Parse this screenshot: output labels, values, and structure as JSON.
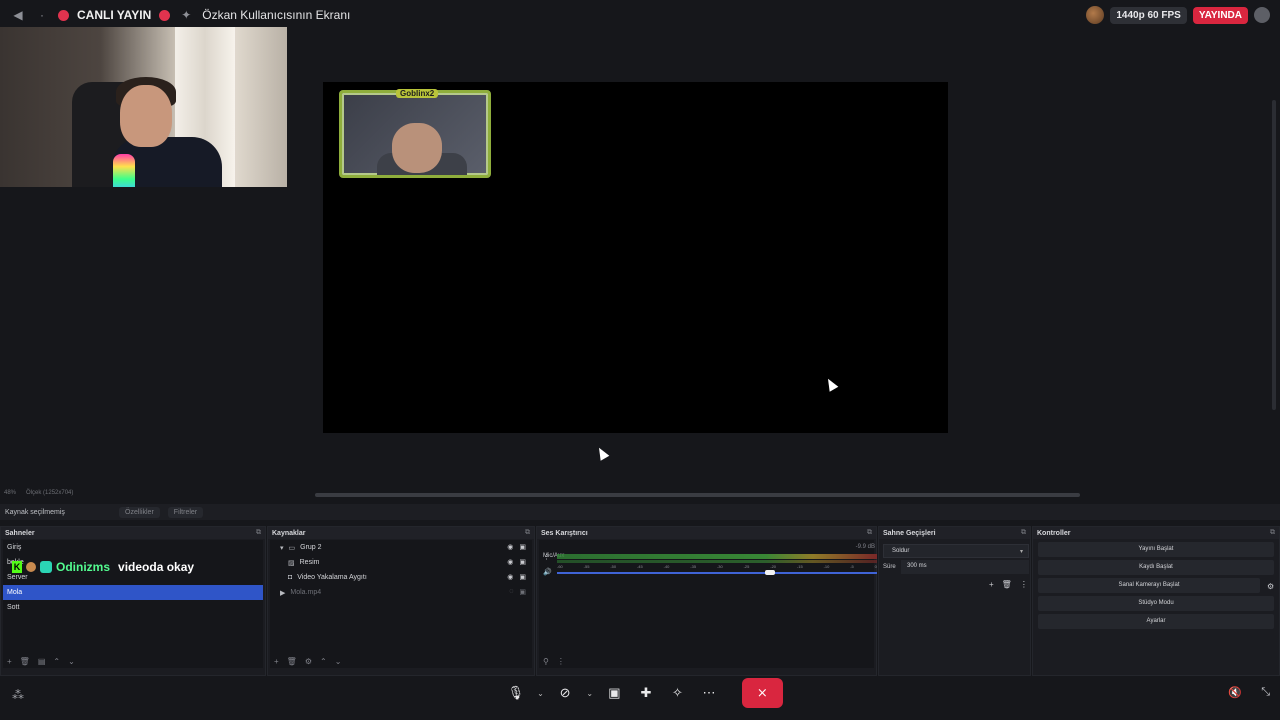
{
  "topbar": {
    "live_label": "CANLI YAYIN",
    "screen_title": "Özkan Kullanıcısının Ekranı",
    "quality": "1440p 60 FPS",
    "status": "YAYINDA"
  },
  "preview": {
    "frame_tag": "Goblinx2"
  },
  "zoombar": {
    "zoom": "48%",
    "size": "Ölçek (1252x704)"
  },
  "source_bar": {
    "none_selected": "Kaynak seçilmemiş",
    "properties": "Özellikler",
    "filters": "Filtreler"
  },
  "scenes": {
    "title": "Sahneler",
    "items": [
      {
        "label": "Giriş"
      },
      {
        "label": "bekle"
      },
      {
        "label": "Server"
      },
      {
        "label": "Mola"
      },
      {
        "label": "Sott"
      }
    ],
    "selected_index": 3
  },
  "sources": {
    "title": "Kaynaklar",
    "items": [
      {
        "label": "Grup 2"
      },
      {
        "label": "Resim"
      },
      {
        "label": "Video Yakalama Aygıtı"
      },
      {
        "label": "Mola.mp4"
      }
    ]
  },
  "mixer": {
    "title": "Ses Karıştırıcı",
    "track_name": "Mic/Aux",
    "track_db": "-9.9 dB",
    "ticks": [
      "-60",
      "-55",
      "-50",
      "-45",
      "-40",
      "-35",
      "-30",
      "-25",
      "-20",
      "-15",
      "-10",
      "-5",
      "0"
    ]
  },
  "transitions": {
    "title": "Sahne Geçişleri",
    "selected": "Soldur",
    "duration_label": "Süre",
    "duration_value": "300 ms"
  },
  "controls": {
    "title": "Kontroller",
    "start_stream": "Yayını Başlat",
    "start_record": "Kaydı Başlat",
    "start_virtualcam": "Sanal Kamerayı Başlat",
    "studio_mode": "Stüdyo Modu",
    "settings": "Ayarlar"
  },
  "overlay": {
    "username": "Odinizms",
    "message": "videoda okay"
  },
  "colors": {
    "live_red": "#d9263f",
    "selection_blue": "#2f55c8",
    "kick_green": "#53fc18"
  }
}
